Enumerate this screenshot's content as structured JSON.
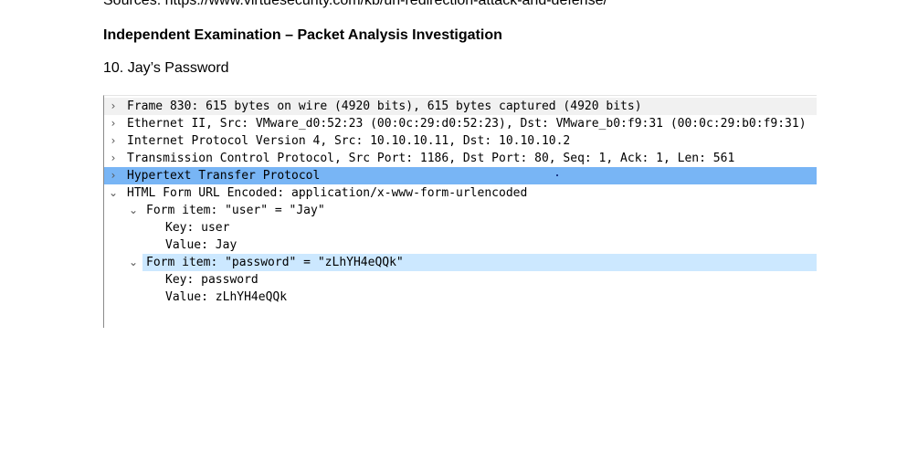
{
  "document": {
    "sources": "Sources: https://www.virtuesecurity.com/kb/url-redirection-attack-and-defense/",
    "heading": "Independent Examination – Packet Analysis Investigation",
    "subheading": "10. Jay’s Password"
  },
  "packet_tree": {
    "frame": "Frame 830: 615 bytes on wire (4920 bits), 615 bytes captured (4920 bits)",
    "ethernet": "Ethernet II, Src: VMware_d0:52:23 (00:0c:29:d0:52:23), Dst: VMware_b0:f9:31 (00:0c:29:b0:f9:31)",
    "ip": "Internet Protocol Version 4, Src: 10.10.10.11, Dst: 10.10.10.2",
    "tcp": "Transmission Control Protocol, Src Port: 1186, Dst Port: 80, Seq: 1, Ack: 1, Len: 561",
    "http": "Hypertext Transfer Protocol",
    "form": "HTML Form URL Encoded: application/x-www-form-urlencoded",
    "item_user": "Form item: \"user\" = \"Jay\"",
    "user_key": "Key: user",
    "user_value": "Value: Jay",
    "item_password": "Form item: \"password\" = \"zLhYH4eQQk\"",
    "password_key": "Key: password",
    "password_value": "Value: zLhYH4eQQk",
    "collapsed_glyph": "›",
    "expanded_glyph": "⌄"
  },
  "colors": {
    "selected_row": "#78b5f5",
    "highlight_row": "#cce8ff",
    "shaded_row": "#f1f1f1"
  },
  "icons": [
    "chevron-right-icon",
    "chevron-down-icon"
  ]
}
